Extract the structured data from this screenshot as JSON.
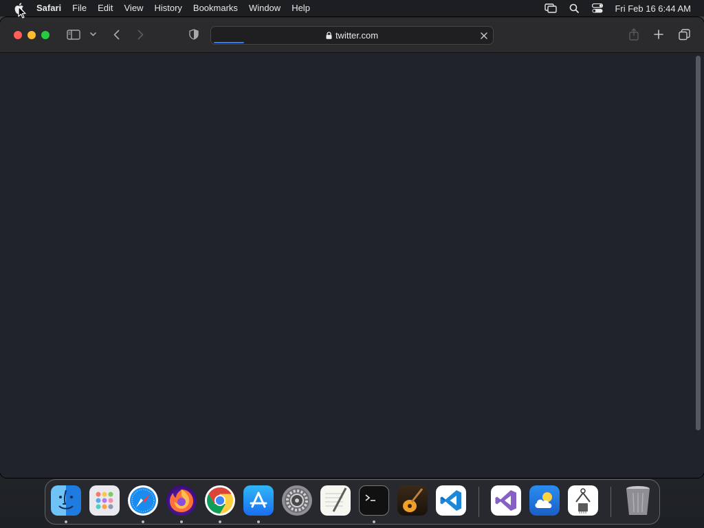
{
  "menubar": {
    "app_name": "Safari",
    "items": [
      "File",
      "Edit",
      "View",
      "History",
      "Bookmarks",
      "Window",
      "Help"
    ],
    "clock": "Fri Feb 16  6:44 AM",
    "status_icons": [
      "screen-mirroring-icon",
      "spotlight-icon",
      "control-center-icon"
    ]
  },
  "browser": {
    "url": "twitter.com",
    "loading_progress": 0.11,
    "toolbar_icons": [
      "sidebar-icon",
      "chevron-down-icon",
      "back-icon",
      "forward-icon",
      "privacy-shield-icon",
      "share-icon",
      "new-tab-icon",
      "tab-overview-icon"
    ]
  },
  "dock": {
    "apps": [
      {
        "name": "Finder",
        "icon": "finder-icon",
        "running": true
      },
      {
        "name": "Launchpad",
        "icon": "launchpad-icon",
        "running": false
      },
      {
        "name": "Safari",
        "icon": "safari-icon",
        "running": true
      },
      {
        "name": "Firefox",
        "icon": "firefox-icon",
        "running": true
      },
      {
        "name": "Google Chrome",
        "icon": "chrome-icon",
        "running": true
      },
      {
        "name": "App Store",
        "icon": "app-store-icon",
        "running": true
      },
      {
        "name": "System Settings",
        "icon": "system-settings-icon",
        "running": false
      },
      {
        "name": "TextEdit",
        "icon": "textedit-icon",
        "running": false
      },
      {
        "name": "Terminal",
        "icon": "terminal-icon",
        "running": true
      },
      {
        "name": "GarageBand",
        "icon": "garageband-icon",
        "running": false
      },
      {
        "name": "Visual Studio Code",
        "icon": "vscode-icon",
        "running": false
      },
      {
        "name": "Visual Studio",
        "icon": "visual-studio-icon",
        "running": false
      },
      {
        "name": "Weather",
        "icon": "weather-icon",
        "running": false
      },
      {
        "name": "System Information",
        "icon": "system-information-icon",
        "running": false
      },
      {
        "name": "Trash",
        "icon": "trash-icon",
        "running": false
      }
    ]
  },
  "colors": {
    "accent": "#2f7cf6",
    "close": "#ff5f57",
    "minimize": "#febc2e",
    "zoom": "#28c840",
    "page_background": "#20222c"
  }
}
